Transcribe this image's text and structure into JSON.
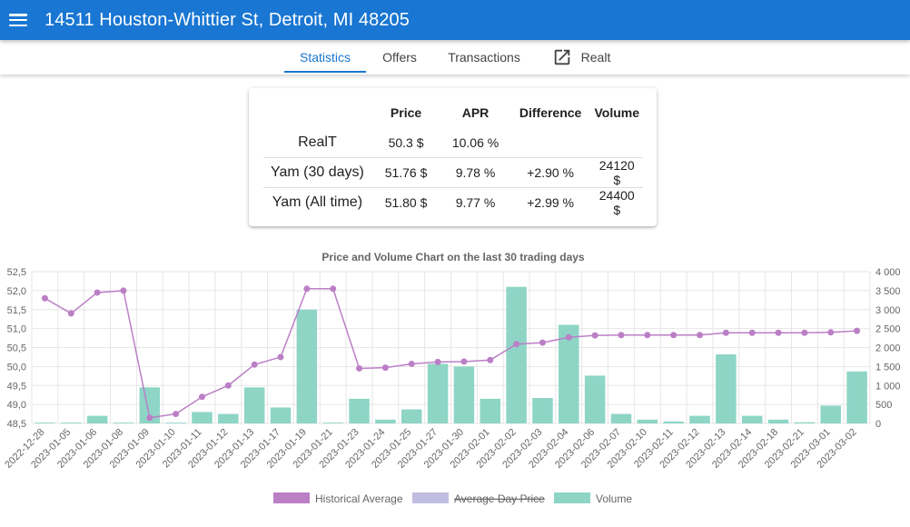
{
  "app": {
    "title": "14511 Houston-Whittier St, Detroit, MI 48205"
  },
  "tabs": [
    {
      "label": "Statistics",
      "active": true
    },
    {
      "label": "Offers"
    },
    {
      "label": "Transactions"
    },
    {
      "label": "Realt",
      "icon": "open-in-new-icon"
    }
  ],
  "stats_table": {
    "headers": [
      "",
      "Price",
      "APR",
      "Difference",
      "Volume"
    ],
    "rows": [
      {
        "label": "RealT",
        "price": "50.3 $",
        "apr": "10.06 %",
        "difference": "",
        "volume": ""
      },
      {
        "label": "Yam (30 days)",
        "price": "51.76 $",
        "apr": "9.78 %",
        "difference": "+2.90 %",
        "volume": "24120 $"
      },
      {
        "label": "Yam (All time)",
        "price": "51.80 $",
        "apr": "9.77 %",
        "difference": "+2.99 %",
        "volume": "24400 $"
      }
    ]
  },
  "colors": {
    "primary": "#1976d2",
    "historical": "#bb7fc6",
    "average_day": "#c0bde0",
    "volume": "#8ed5c6"
  },
  "chart_data": {
    "type": "bar",
    "title": "Price and Volume Chart on the last 30 trading days",
    "categories": [
      "2022-12-28",
      "2023-01-05",
      "2023-01-06",
      "2023-01-08",
      "2023-01-09",
      "2023-01-10",
      "2023-01-11",
      "2023-01-12",
      "2023-01-13",
      "2023-01-17",
      "2023-01-19",
      "2023-01-21",
      "2023-01-23",
      "2023-01-24",
      "2023-01-25",
      "2023-01-27",
      "2023-01-30",
      "2023-02-01",
      "2023-02-02",
      "2023-02-03",
      "2023-02-04",
      "2023-02-06",
      "2023-02-07",
      "2023-02-10",
      "2023-02-11",
      "2023-02-12",
      "2023-02-13",
      "2023-02-14",
      "2023-02-18",
      "2023-02-21",
      "2023-03-01",
      "2023-03-02"
    ],
    "series": [
      {
        "name": "Historical Average",
        "type": "line",
        "axis": "left",
        "values": [
          51.8,
          51.4,
          51.95,
          52.0,
          48.65,
          48.75,
          49.2,
          49.5,
          50.05,
          50.25,
          52.05,
          52.05,
          49.95,
          49.97,
          50.07,
          50.12,
          50.13,
          50.17,
          50.59,
          50.63,
          50.77,
          50.82,
          50.83,
          50.83,
          50.83,
          50.83,
          50.89,
          50.89,
          50.89,
          50.89,
          50.9,
          50.94
        ]
      },
      {
        "name": "Average Day Price",
        "type": "line",
        "axis": "left",
        "hidden": true,
        "values": []
      },
      {
        "name": "Volume",
        "type": "bar",
        "axis": "right",
        "values": [
          20,
          20,
          200,
          20,
          950,
          20,
          300,
          250,
          950,
          420,
          3000,
          20,
          650,
          100,
          370,
          1570,
          1500,
          650,
          3600,
          670,
          2600,
          1260,
          250,
          100,
          50,
          200,
          1820,
          200,
          100,
          30,
          470,
          1370
        ]
      }
    ],
    "y_left": {
      "min": 48.5,
      "max": 52.5,
      "ticks": [
        "52,5",
        "52,0",
        "51,5",
        "51,0",
        "50,5",
        "50,0",
        "49,5",
        "49,0",
        "48,5"
      ]
    },
    "y_right": {
      "min": 0,
      "max": 4000,
      "ticks": [
        "4 000",
        "3 500",
        "3 000",
        "2 500",
        "2 000",
        "1 500",
        "1 000",
        "500",
        "0"
      ]
    },
    "grid": true,
    "legend_position": "bottom"
  }
}
